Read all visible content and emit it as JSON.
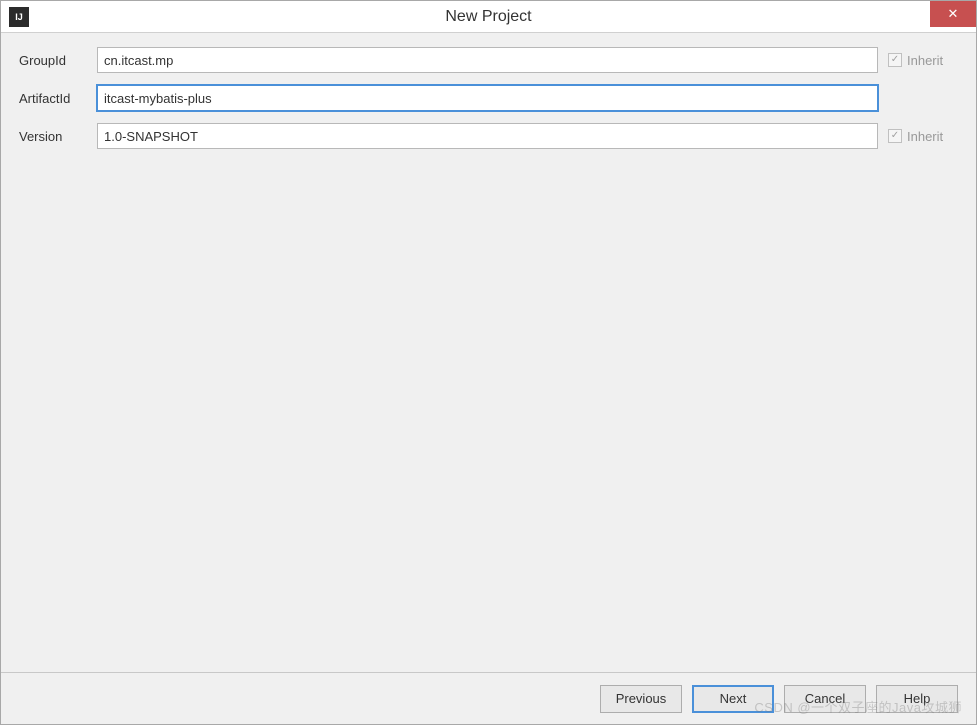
{
  "window": {
    "title": "New Project",
    "app_icon_text": "IJ"
  },
  "form": {
    "groupId": {
      "label": "GroupId",
      "value": "cn.itcast.mp",
      "inherit_label": "Inherit",
      "inherit_checked": true
    },
    "artifactId": {
      "label": "ArtifactId",
      "value": "itcast-mybatis-plus"
    },
    "version": {
      "label": "Version",
      "value": "1.0-SNAPSHOT",
      "inherit_label": "Inherit",
      "inherit_checked": true
    }
  },
  "footer": {
    "previous": "Previous",
    "next": "Next",
    "cancel": "Cancel",
    "help": "Help"
  },
  "watermark": "CSDN @一个双子座的Java攻城狮"
}
